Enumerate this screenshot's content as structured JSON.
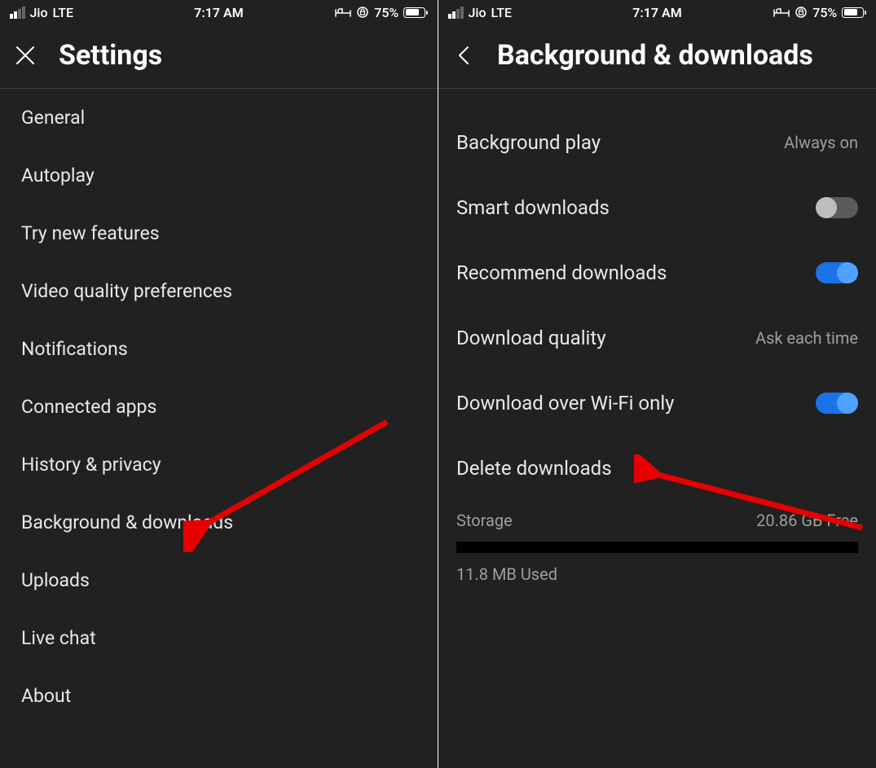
{
  "status_bar": {
    "carrier": "Jio",
    "network": "LTE",
    "time": "7:17 AM",
    "battery_text": "75%",
    "battery_level": 75
  },
  "settings_screen": {
    "title": "Settings",
    "items": [
      "General",
      "Autoplay",
      "Try new features",
      "Video quality preferences",
      "Notifications",
      "Connected apps",
      "History & privacy",
      "Background & downloads",
      "Uploads",
      "Live chat",
      "About"
    ]
  },
  "downloads_screen": {
    "title": "Background & downloads",
    "rows": {
      "background_play": {
        "label": "Background play",
        "value": "Always on"
      },
      "smart_downloads": {
        "label": "Smart downloads",
        "on": false
      },
      "recommend_downloads": {
        "label": "Recommend downloads",
        "on": true
      },
      "download_quality": {
        "label": "Download quality",
        "value": "Ask each time"
      },
      "wifi_only": {
        "label": "Download over Wi-Fi only",
        "on": true
      },
      "delete_downloads": {
        "label": "Delete downloads"
      }
    },
    "storage": {
      "label": "Storage",
      "free": "20.86 GB Free",
      "used": "11.8 MB Used"
    }
  }
}
